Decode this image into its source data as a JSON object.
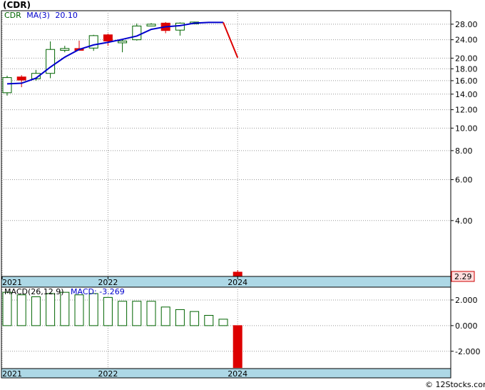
{
  "title": "(CDR)",
  "watermark": "© 12Stocks.com",
  "colors": {
    "up": "#006400",
    "down": "#dd0000",
    "ma": "#0000cc",
    "band": "#add8e6",
    "macd_bar": "#006400"
  },
  "chart_data": [
    {
      "type": "candlestick",
      "legend": {
        "ticker": "CDR",
        "ma_label": "MA(3)",
        "ma_value": "20.10"
      },
      "last_price_label": "2.29",
      "y_scale": "log",
      "ylim": [
        2.3,
        32
      ],
      "yticks": [
        "28.00",
        "24.00",
        "20.00",
        "18.00",
        "16.00",
        "14.00",
        "12.00",
        "10.00",
        "8.00",
        "6.00",
        "4.00"
      ],
      "x_labels": [
        {
          "label": "2021",
          "at": 0
        },
        {
          "label": "2022",
          "at": 7
        },
        {
          "label": "2024",
          "at": 16
        }
      ],
      "grid": true,
      "candles": [
        {
          "i": 0,
          "o": 14.2,
          "h": 16.8,
          "l": 13.8,
          "c": 16.5
        },
        {
          "i": 1,
          "o": 16.6,
          "h": 16.9,
          "l": 15.0,
          "c": 16.1
        },
        {
          "i": 2,
          "o": 16.3,
          "h": 17.8,
          "l": 16.0,
          "c": 17.2
        },
        {
          "i": 3,
          "o": 17.2,
          "h": 23.6,
          "l": 16.4,
          "c": 21.8
        },
        {
          "i": 4,
          "o": 21.9,
          "h": 22.6,
          "l": 21.2,
          "c": 22.0
        },
        {
          "i": 5,
          "o": 22.0,
          "h": 23.8,
          "l": 21.9,
          "c": 21.7
        },
        {
          "i": 6,
          "o": 22.1,
          "h": 25.2,
          "l": 21.5,
          "c": 25.0
        },
        {
          "i": 7,
          "o": 25.2,
          "h": 25.5,
          "l": 22.6,
          "c": 23.7
        },
        {
          "i": 8,
          "o": 23.5,
          "h": 24.0,
          "l": 21.2,
          "c": 23.7
        },
        {
          "i": 9,
          "o": 24.0,
          "h": 28.2,
          "l": 23.8,
          "c": 27.5
        },
        {
          "i": 10,
          "o": 27.9,
          "h": 28.3,
          "l": 27.5,
          "c": 28.0
        },
        {
          "i": 11,
          "o": 28.3,
          "h": 28.6,
          "l": 25.6,
          "c": 26.3
        },
        {
          "i": 12,
          "o": 26.4,
          "h": 28.5,
          "l": 25.0,
          "c": 28.3
        },
        {
          "i": 13,
          "o": 28.4,
          "h": 28.7,
          "l": 28.2,
          "c": 28.6
        },
        {
          "i": 16,
          "o": 2.4,
          "h": 2.45,
          "l": 2.3,
          "c": 2.3
        }
      ],
      "ma": [
        {
          "i": 0,
          "v": 15.5
        },
        {
          "i": 1,
          "v": 15.6
        },
        {
          "i": 2,
          "v": 16.4
        },
        {
          "i": 3,
          "v": 18.3
        },
        {
          "i": 4,
          "v": 20.2
        },
        {
          "i": 5,
          "v": 21.8
        },
        {
          "i": 6,
          "v": 22.8
        },
        {
          "i": 7,
          "v": 23.4
        },
        {
          "i": 8,
          "v": 24.1
        },
        {
          "i": 9,
          "v": 24.9
        },
        {
          "i": 10,
          "v": 26.6
        },
        {
          "i": 11,
          "v": 27.3
        },
        {
          "i": 12,
          "v": 27.6
        },
        {
          "i": 13,
          "v": 28.3
        },
        {
          "i": 14,
          "v": 28.5
        },
        {
          "i": 15,
          "v": 28.5
        }
      ],
      "ma_drop": [
        {
          "i": 15,
          "v": 28.5
        },
        {
          "i": 16,
          "v": 20.1
        }
      ]
    },
    {
      "type": "bar",
      "legend": {
        "name": "MACD(26,12,9)",
        "label": "MACD:",
        "value": "-3.269"
      },
      "ylim": [
        -3.35,
        3.0
      ],
      "yticks": [
        "2.000",
        "0.000",
        "-2.000"
      ],
      "ytick_values": [
        2,
        0,
        -2
      ],
      "x_labels": [
        {
          "label": "2021",
          "at": 0
        },
        {
          "label": "2022",
          "at": 7
        },
        {
          "label": "2024",
          "at": 16
        }
      ],
      "grid": true,
      "bars": [
        {
          "i": 0,
          "v": 2.6
        },
        {
          "i": 1,
          "v": 2.4
        },
        {
          "i": 2,
          "v": 2.25
        },
        {
          "i": 3,
          "v": 2.5
        },
        {
          "i": 4,
          "v": 2.6
        },
        {
          "i": 5,
          "v": 2.4
        },
        {
          "i": 6,
          "v": 2.5
        },
        {
          "i": 7,
          "v": 2.2
        },
        {
          "i": 8,
          "v": 1.9
        },
        {
          "i": 9,
          "v": 1.9
        },
        {
          "i": 10,
          "v": 1.9
        },
        {
          "i": 11,
          "v": 1.45
        },
        {
          "i": 12,
          "v": 1.25
        },
        {
          "i": 13,
          "v": 1.1
        },
        {
          "i": 14,
          "v": 0.8
        },
        {
          "i": 15,
          "v": 0.5
        },
        {
          "i": 16,
          "v": -3.269
        }
      ]
    }
  ]
}
